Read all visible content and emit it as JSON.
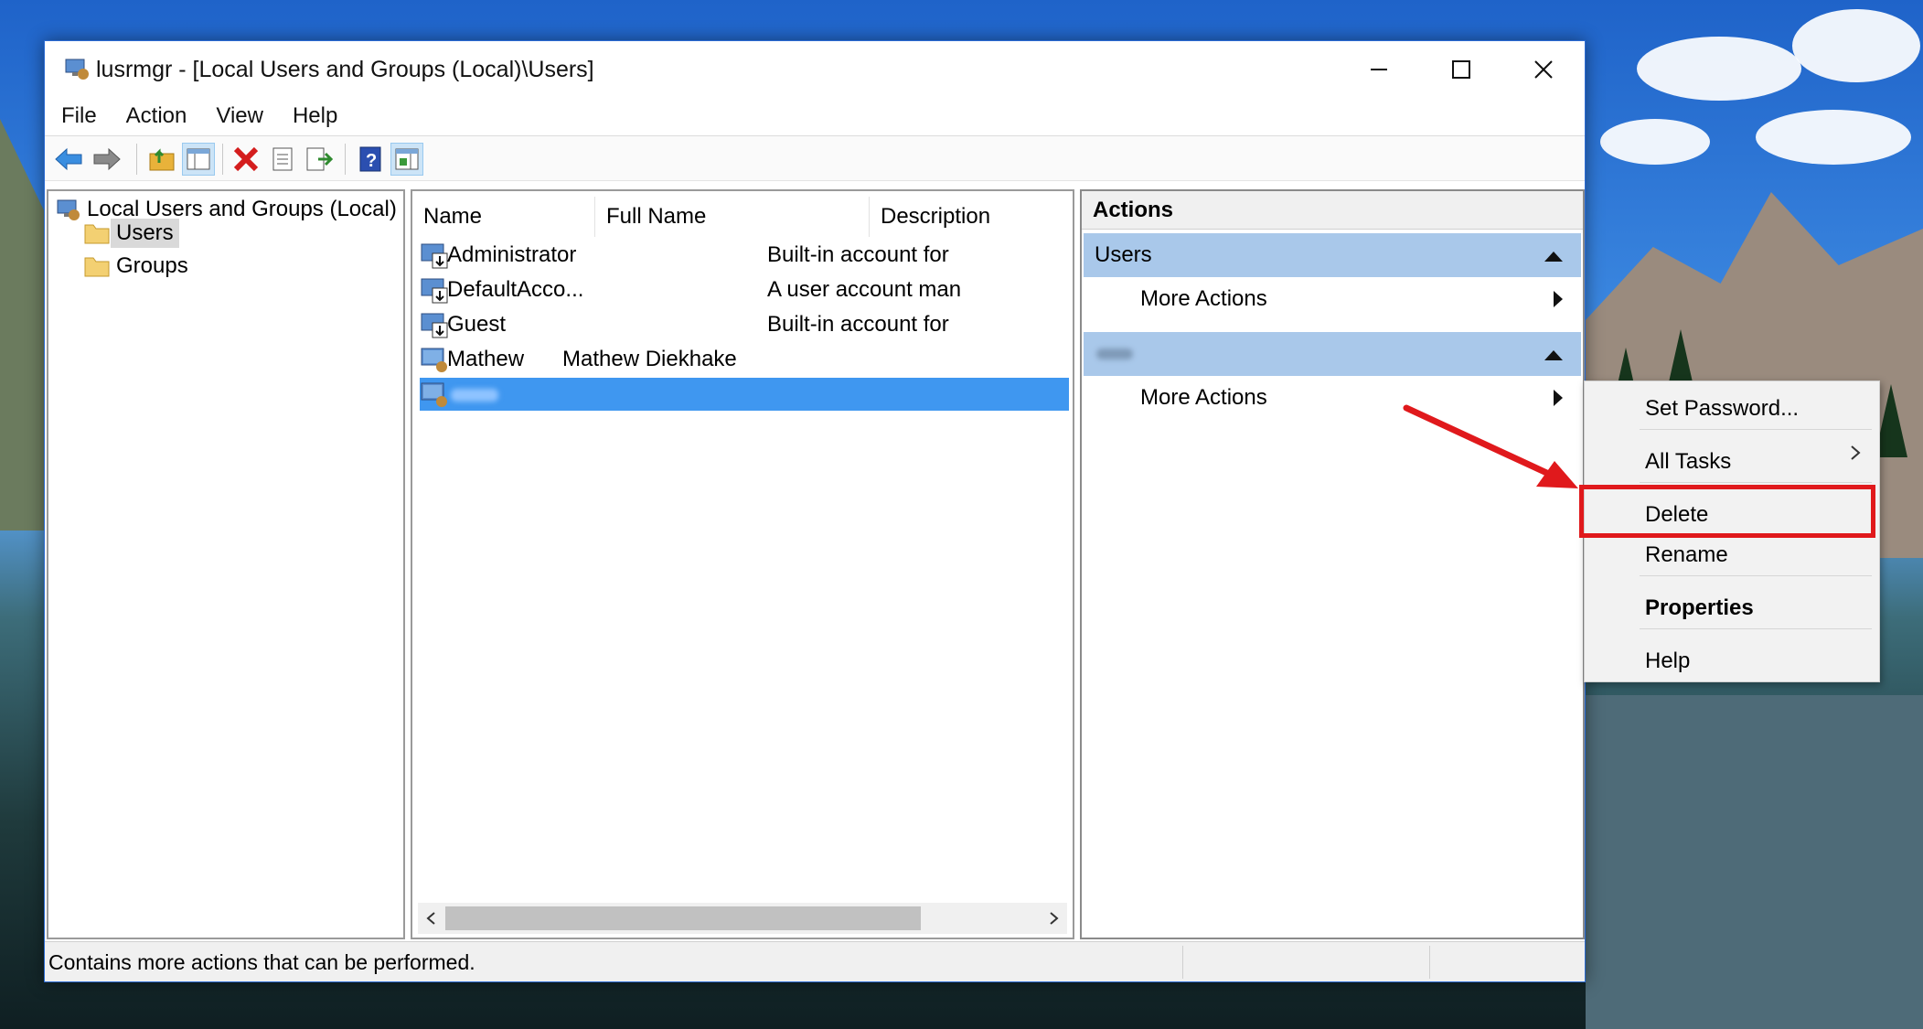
{
  "window": {
    "title": "lusrmgr - [Local Users and Groups (Local)\\Users]"
  },
  "menu": [
    "File",
    "Action",
    "View",
    "Help"
  ],
  "toolbar_icons": [
    "back-arrow-icon",
    "forward-arrow-icon",
    "up-folder-icon",
    "show-hide-tree-icon",
    "delete-icon",
    "properties-icon",
    "export-list-icon",
    "help-icon",
    "show-hide-action-pane-icon"
  ],
  "tree": {
    "root": "Local Users and Groups (Local)",
    "children": [
      "Users",
      "Groups"
    ],
    "selected": "Users"
  },
  "list": {
    "columns": [
      "Name",
      "Full Name",
      "Description"
    ],
    "rows": [
      {
        "name": "Administrator",
        "full_name": "",
        "description": "Built-in account for"
      },
      {
        "name": "DefaultAcco...",
        "full_name": "",
        "description": "A user account man"
      },
      {
        "name": "Guest",
        "full_name": "",
        "description": "Built-in account for"
      },
      {
        "name": "Mathew",
        "full_name": "Mathew Diekhake",
        "description": ""
      },
      {
        "name": "",
        "full_name": "",
        "description": ""
      }
    ]
  },
  "actions": {
    "title": "Actions",
    "groups": [
      {
        "label": "Users",
        "item": "More Actions"
      },
      {
        "label": "",
        "item": "More Actions"
      }
    ]
  },
  "context_menu": {
    "items": [
      "Set Password...",
      "All Tasks",
      "Delete",
      "Rename",
      "Properties",
      "Help"
    ],
    "highlighted": "Delete"
  },
  "status": {
    "text": "Contains more actions that can be performed."
  },
  "colors": {
    "selection": "#3f97f0",
    "action_group": "#a9c8ea",
    "highlight_box": "#e0191c",
    "arrow": "#e0191c"
  }
}
